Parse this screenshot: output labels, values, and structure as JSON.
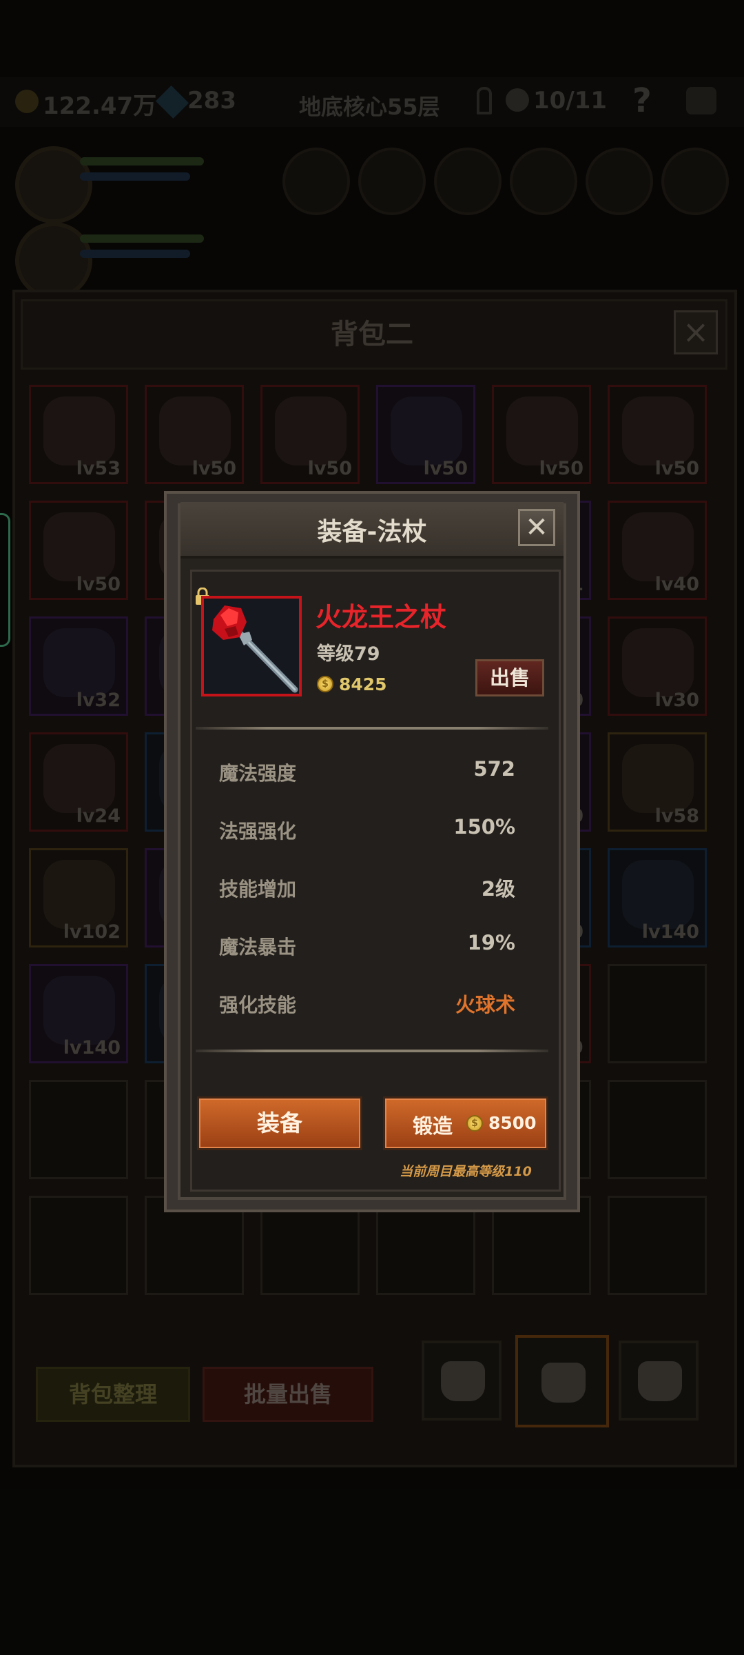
{
  "background": {
    "currency_gold": "122.47万",
    "currency_gems": "283",
    "location": "地底核心55层",
    "key_count": "10/11",
    "help_label": "?",
    "backpack_title": "背包二",
    "slots": [
      {
        "level": "lv53",
        "rarity": "r"
      },
      {
        "level": "lv50",
        "rarity": "r"
      },
      {
        "level": "lv50",
        "rarity": "r"
      },
      {
        "level": "lv50",
        "rarity": "p"
      },
      {
        "level": "lv50",
        "rarity": "r"
      },
      {
        "level": "lv50",
        "rarity": "r"
      },
      {
        "level": "lv50",
        "rarity": "r"
      },
      {
        "level": "",
        "rarity": "r"
      },
      {
        "level": "",
        "rarity": ""
      },
      {
        "level": "",
        "rarity": ""
      },
      {
        "level": "1",
        "rarity": "p"
      },
      {
        "level": "lv40",
        "rarity": "r"
      },
      {
        "level": "lv32",
        "rarity": "p"
      },
      {
        "level": "",
        "rarity": "p"
      },
      {
        "level": "",
        "rarity": ""
      },
      {
        "level": "",
        "rarity": ""
      },
      {
        "level": "0",
        "rarity": "p"
      },
      {
        "level": "lv30",
        "rarity": "r"
      },
      {
        "level": "lv24",
        "rarity": "r"
      },
      {
        "level": "",
        "rarity": "b"
      },
      {
        "level": "",
        "rarity": ""
      },
      {
        "level": "",
        "rarity": ""
      },
      {
        "level": "0",
        "rarity": "p"
      },
      {
        "level": "lv58",
        "rarity": "g"
      },
      {
        "level": "lv102",
        "rarity": "g"
      },
      {
        "level": "",
        "rarity": "p"
      },
      {
        "level": "",
        "rarity": ""
      },
      {
        "level": "",
        "rarity": ""
      },
      {
        "level": "0",
        "rarity": "b"
      },
      {
        "level": "lv140",
        "rarity": "b"
      },
      {
        "level": "lv140",
        "rarity": "p"
      },
      {
        "level": "",
        "rarity": "b"
      },
      {
        "level": "",
        "rarity": ""
      },
      {
        "level": "",
        "rarity": ""
      },
      {
        "level": "9",
        "rarity": "r"
      },
      {
        "level": "",
        "rarity": ""
      },
      {
        "level": "",
        "rarity": ""
      },
      {
        "level": "",
        "rarity": ""
      },
      {
        "level": "",
        "rarity": ""
      },
      {
        "level": "",
        "rarity": ""
      },
      {
        "level": "",
        "rarity": ""
      },
      {
        "level": "",
        "rarity": ""
      },
      {
        "level": "",
        "rarity": ""
      },
      {
        "level": "",
        "rarity": ""
      },
      {
        "level": "",
        "rarity": ""
      },
      {
        "level": "",
        "rarity": ""
      },
      {
        "level": "",
        "rarity": ""
      },
      {
        "level": "",
        "rarity": ""
      }
    ],
    "sort_button": "背包整理",
    "bulk_sell_button": "批量出售"
  },
  "modal": {
    "title": "装备-法杖",
    "close_icon": "close-icon",
    "item": {
      "name": "火龙王之杖",
      "level": "等级79",
      "price": "8425",
      "locked_icon": "lock-icon",
      "name_color": "#e8242b"
    },
    "sell_button": "出售",
    "stats": [
      {
        "label": "魔法强度",
        "value": "572",
        "color": "#c9c2b3"
      },
      {
        "label": "法强强化",
        "value": "150%",
        "color": "#c9c2b3"
      },
      {
        "label": "技能增加",
        "value": "2级",
        "color": "#c9c2b3"
      },
      {
        "label": "魔法暴击",
        "value": "19%",
        "color": "#c9c2b3"
      },
      {
        "label": "强化技能",
        "value": "火球术",
        "color": "#e0742c"
      }
    ],
    "equip_button": "装备",
    "forge_button": "锻造",
    "forge_cost": "8500",
    "forge_note": "当前周目最高等级110"
  }
}
